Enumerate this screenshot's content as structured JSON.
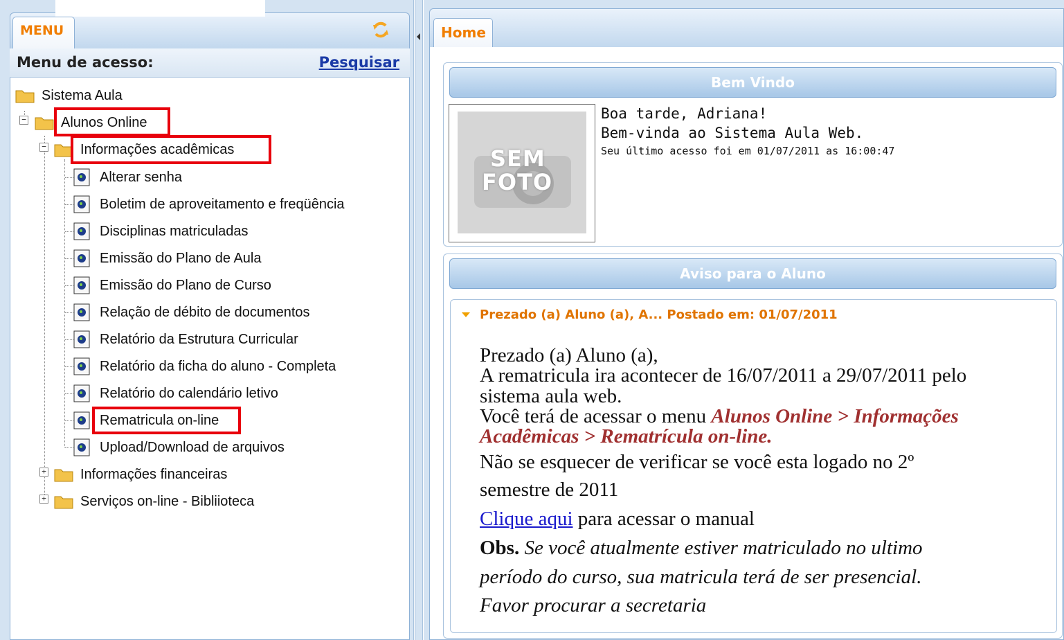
{
  "menu": {
    "tab_label": "MENU",
    "header_title": "Menu de acesso:",
    "search_link": "Pesquisar",
    "tree": {
      "root": "Sistema Aula",
      "alunos_online": "Alunos Online",
      "info_academicas": "Informações acadêmicas",
      "items": [
        "Alterar senha",
        "Boletim de aproveitamento e freqüência",
        "Disciplinas matriculadas",
        "Emissão do Plano de Aula",
        "Emissão do Plano de Curso",
        "Relação de débito de documentos",
        "Relatório da Estrutura Curricular",
        "Relatório da ficha do aluno - Completa",
        "Relatório do calendário letivo",
        "Rematricula on-line",
        "Upload/Download de arquivos"
      ],
      "info_financeiras": "Informações financeiras",
      "servicos": "Serviços on-line - Bibliioteca"
    }
  },
  "home": {
    "tab_label": "Home",
    "welcome": {
      "title": "Bem Vindo",
      "photo_line1": "SEM",
      "photo_line2": "FOTO",
      "greeting": "Boa tarde, Adriana!",
      "message": "Bem-vinda ao Sistema Aula Web.",
      "last_access": "Seu último acesso foi em 01/07/2011 as 16:00:47"
    },
    "notice": {
      "title": "Aviso para o Aluno",
      "post_title": "Prezado (a) Aluno (a), A... Postado em: 01/07/2011",
      "line1": "Prezado (a) Aluno (a),",
      "line2": "A rematricula ira acontecer de 16/07/2011 a 29/07/2011 pelo",
      "line3": "sistema aula web.",
      "line4_prefix": "Você terá de acessar o menu ",
      "line4_path": "Alunos Online > Informações",
      "line5_path": "Acadêmicas > Rematrícula on-line.",
      "line6": "Não se esquecer de verificar se você esta logado no 2º",
      "line7": "semestre de 2011",
      "link_text": "Clique aqui",
      "link_suffix": " para acessar o manual",
      "obs_label": "Obs.",
      "obs_text1": " Se você atualmente estiver matriculado no ultimo",
      "obs_text2": "período do curso, sua matricula terá de ser presencial.",
      "obs_text3": "Favor procurar a secretaria"
    }
  },
  "colors": {
    "accent_orange": "#f07d00",
    "highlight_red": "#e8000c",
    "header_blue": "#a7c7e7"
  }
}
